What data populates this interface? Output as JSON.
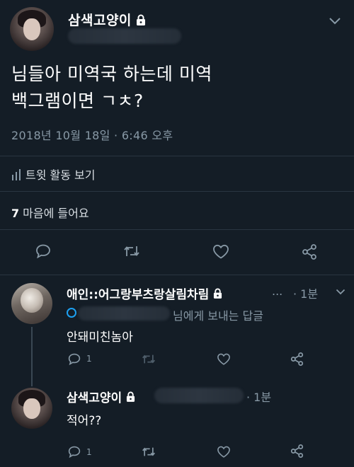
{
  "tweet": {
    "author": "삼색고양이",
    "lines": [
      "님들아 미역국 하는데 미역",
      "백그램이면 ㄱㅊ?"
    ],
    "timestamp": "2018년 10월 18일 · 6:46 오후",
    "activity_label": "트윗 활동 보기",
    "likes_count": "7",
    "likes_label": "마음에 들어요"
  },
  "replies": [
    {
      "author": "애인::어그랑부츠랑살림차림",
      "ellipsis": "...",
      "time": "· 1분",
      "reply_to_suffix": "님에게 보내는 답글",
      "text": "안돼미친놈아",
      "reply_count": "1"
    },
    {
      "author": "삼색고양이",
      "time": "· 1분",
      "text": "적어??",
      "reply_count": "1"
    }
  ],
  "colors": {
    "background": "#141d26",
    "secondary_text": "#8899a6",
    "divider": "#2a3641",
    "accent": "#1da1f2"
  },
  "icons": [
    "lock-icon",
    "bar-chart-icon",
    "reply-icon",
    "retweet-icon",
    "heart-icon",
    "share-icon",
    "chevron-down-icon"
  ]
}
